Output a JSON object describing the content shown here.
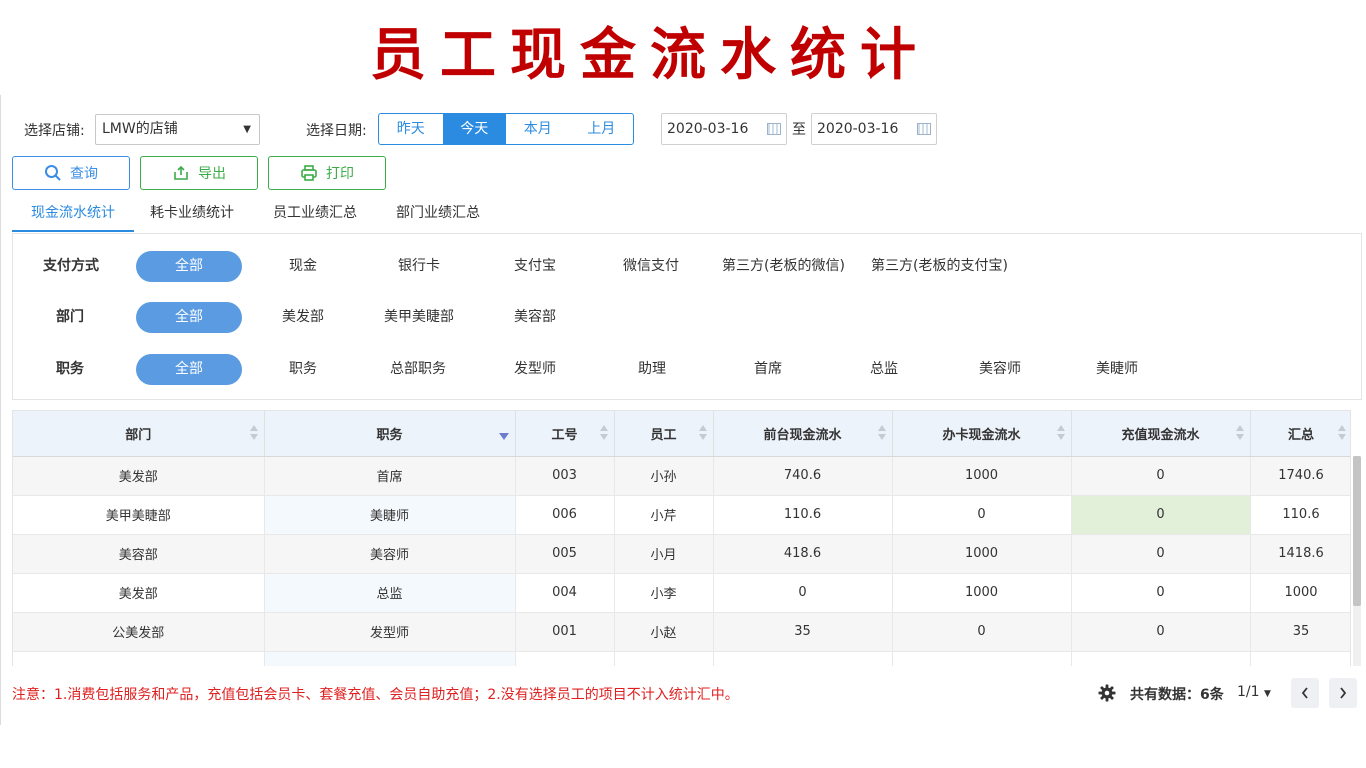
{
  "page_title": "员工现金流水统计",
  "toolbar": {
    "store_label": "选择店铺:",
    "store_value": "LMW的店铺",
    "date_label": "选择日期:",
    "date_ranges": [
      "昨天",
      "今天",
      "本月",
      "上月"
    ],
    "date_from": "2020-03-16",
    "date_sep": "至",
    "date_to": "2020-03-16",
    "query_label": "查询",
    "export_label": "导出",
    "print_label": "打印"
  },
  "tabs": [
    "现金流水统计",
    "耗卡业绩统计",
    "员工业绩汇总",
    "部门业绩汇总"
  ],
  "filters": {
    "payment": {
      "label": "支付方式",
      "selected": "全部",
      "options": [
        "现金",
        "银行卡",
        "支付宝",
        "微信支付",
        "第三方(老板的微信)",
        "第三方(老板的支付宝)"
      ]
    },
    "department": {
      "label": "部门",
      "selected": "全部",
      "options": [
        "美发部",
        "美甲美睫部",
        "美容部"
      ]
    },
    "position": {
      "label": "职务",
      "selected": "全部",
      "options": [
        "职务",
        "总部职务",
        "发型师",
        "助理",
        "首席",
        "总监",
        "美容师",
        "美睫师"
      ]
    }
  },
  "table": {
    "headers": [
      "部门",
      "职务",
      "工号",
      "员工",
      "前台现金流水",
      "办卡现金流水",
      "充值现金流水",
      "汇总"
    ],
    "rows": [
      [
        "美发部",
        "首席",
        "003",
        "小孙",
        "740.6",
        "1000",
        "0",
        "1740.6"
      ],
      [
        "美甲美睫部",
        "美睫师",
        "006",
        "小芹",
        "110.6",
        "0",
        "0",
        "110.6"
      ],
      [
        "美容部",
        "美容师",
        "005",
        "小月",
        "418.6",
        "1000",
        "0",
        "1418.6"
      ],
      [
        "美发部",
        "总监",
        "004",
        "小李",
        "0",
        "1000",
        "0",
        "1000"
      ],
      [
        "公美发部",
        "发型师",
        "001",
        "小赵",
        "35",
        "0",
        "0",
        "35"
      ]
    ]
  },
  "footer": {
    "note": "注意：1.消费包括服务和产品，充值包括会员卡、套餐充值、会员自助充值；2.没有选择员工的项目不计入统计汇中。",
    "total_label": "共有数据：6条",
    "page_info": "1/1",
    "prev_icon": "chevron-left-icon",
    "next_icon": "chevron-right-icon"
  },
  "colors": {
    "title": "#c00000",
    "accent": "#2b8be0",
    "pill": "#5a9be2",
    "export_green": "#3cac48",
    "note_red": "#e02020",
    "highlight_cell": "#e2efd9"
  }
}
